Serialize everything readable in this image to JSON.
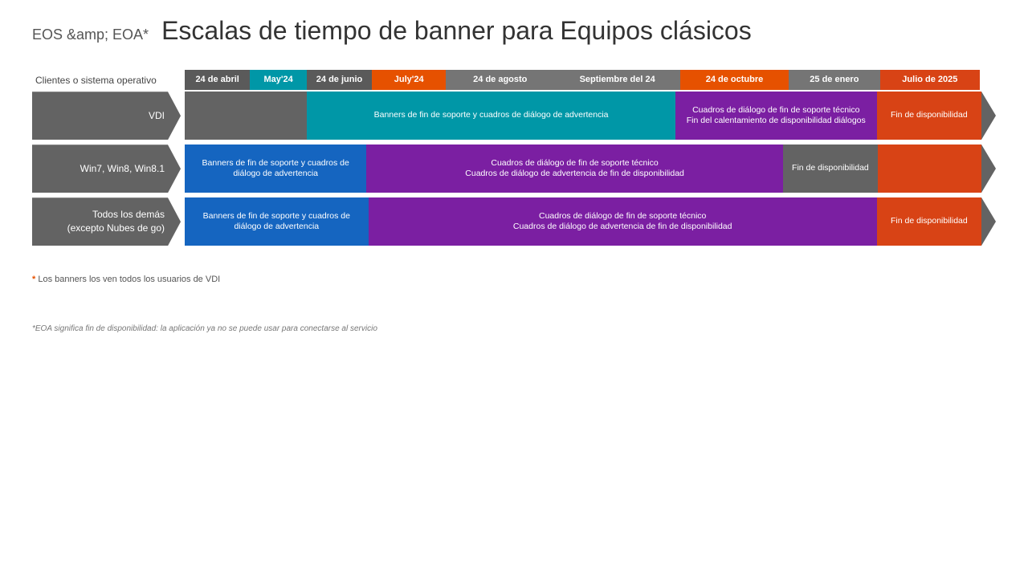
{
  "header": {
    "prefix": "EOS &amp; EOA*",
    "title": "Escalas de tiempo de banner para Equipos clásicos"
  },
  "timeline": {
    "label_col": "Clientes o sistema operativo",
    "date_headers": [
      {
        "id": "apr",
        "label": "24 de abril",
        "color": "#5a5a5a",
        "flex": 7
      },
      {
        "id": "may",
        "label": "May'24",
        "color": "#0097a7",
        "flex": 6
      },
      {
        "id": "jun",
        "label": "24 de junio",
        "color": "#5a5a5a",
        "flex": 7
      },
      {
        "id": "jul",
        "label": "July'24",
        "color": "#e65100",
        "flex": 8
      },
      {
        "id": "aug",
        "label": "24 de agosto",
        "color": "#757575",
        "flex": 12
      },
      {
        "id": "sep",
        "label": "Septiembre del 24",
        "color": "#757575",
        "flex": 14
      },
      {
        "id": "oct",
        "label": "24 de octubre",
        "color": "#e65100",
        "flex": 12
      },
      {
        "id": "jan",
        "label": "25 de enero",
        "color": "#757575",
        "flex": 10
      },
      {
        "id": "jul25",
        "label": "Julio de 2025",
        "color": "#d84315",
        "flex": 11
      }
    ],
    "rows": [
      {
        "id": "vdi",
        "label": "VDI",
        "segments": [
          {
            "color": "#636363",
            "flex": 13,
            "text": ""
          },
          {
            "color": "#0097a7",
            "flex": 41,
            "text": "Banners de fin de soporte y cuadros de diálogo de advertencia"
          },
          {
            "color": "#7b1fa2",
            "flex": 22,
            "text": "Cuadros de diálogo de fin de soporte técnico\nFin del calentamiento de disponibilidad diálogos"
          },
          {
            "color": "#d84315",
            "flex": 11,
            "text": "Fin de disponibilidad"
          }
        ]
      },
      {
        "id": "win7",
        "label": "Win7, Win8, Win8.1",
        "segments": [
          {
            "color": "#1565c0",
            "flex": 20,
            "text": "Banners de fin de soporte y cuadros de diálogo de advertencia"
          },
          {
            "color": "#7b1fa2",
            "flex": 47,
            "text": "Cuadros de diálogo de fin de soporte técnico\nCuadros de diálogo de advertencia de fin de disponibilidad"
          },
          {
            "color": "#636363",
            "flex": 10,
            "text": "Fin de disponibilidad"
          },
          {
            "color": "#d84315",
            "flex": 11,
            "text": ""
          }
        ]
      },
      {
        "id": "others",
        "label": "Todos los demás\n(excepto Nubes de go)",
        "segments": [
          {
            "color": "#1565c0",
            "flex": 20,
            "text": "Banners de fin de soporte y cuadros de diálogo de advertencia"
          },
          {
            "color": "#7b1fa2",
            "flex": 57,
            "text": "Cuadros de diálogo de fin de soporte técnico\nCuadros de diálogo de advertencia de fin de disponibilidad"
          },
          {
            "color": "#d84315",
            "flex": 11,
            "text": "Fin de disponibilidad"
          }
        ]
      }
    ]
  },
  "footnotes": {
    "main": "* Los banners los ven todos los usuarios de VDI",
    "eoa": "*EOA significa fin de disponibilidad: la aplicación ya no se puede usar para conectarse al servicio"
  }
}
